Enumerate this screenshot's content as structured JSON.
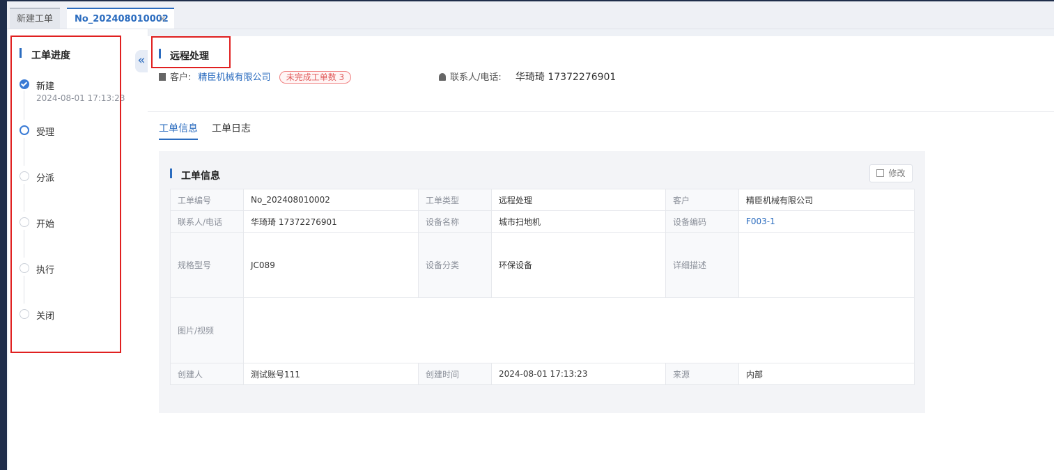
{
  "tabs": {
    "new_tab": "新建工单",
    "active_tab": "No_202408010002",
    "close_glyph": "×"
  },
  "progress": {
    "title": "工单进度",
    "steps": [
      {
        "label": "新建",
        "time": "2024-08-01 17:13:23",
        "state": "done"
      },
      {
        "label": "受理",
        "time": "",
        "state": "active"
      },
      {
        "label": "分派",
        "time": "",
        "state": "pending"
      },
      {
        "label": "开始",
        "time": "",
        "state": "pending"
      },
      {
        "label": "执行",
        "time": "",
        "state": "pending"
      },
      {
        "label": "关闭",
        "time": "",
        "state": "pending"
      }
    ]
  },
  "collapse_glyph": "«",
  "header": {
    "title": "远程处理",
    "customer_label": "客户:",
    "customer_name": "精臣机械有限公司",
    "badge": "未完成工单数 3",
    "contact_label": "联系人/电话:",
    "contact_value": "华琦琦 17372276901"
  },
  "subtabs": [
    "工单信息",
    "工单日志"
  ],
  "card": {
    "title": "工单信息",
    "edit_label": "修改",
    "fields": {
      "order_no_label": "工单编号",
      "order_no": "No_202408010002",
      "type_label": "工单类型",
      "type": "远程处理",
      "customer_label": "客户",
      "customer": "精臣机械有限公司",
      "contact_label": "联系人/电话",
      "contact": "华琦琦 17372276901",
      "device_name_label": "设备名称",
      "device_name": "城市扫地机",
      "device_code_label": "设备编码",
      "device_code": "F003-1",
      "model_label": "规格型号",
      "model": "JC089",
      "category_label": "设备分类",
      "category": "环保设备",
      "desc_label": "详细描述",
      "desc": "",
      "media_label": "图片/视频",
      "creator_label": "创建人",
      "creator": "测试账号111",
      "created_label": "创建时间",
      "created": "2024-08-01 17:13:23",
      "source_label": "来源",
      "source": "内部"
    }
  },
  "colors": {
    "accent": "#2b6cbf",
    "highlight_box": "#e02020",
    "badge": "#e05a5a"
  }
}
